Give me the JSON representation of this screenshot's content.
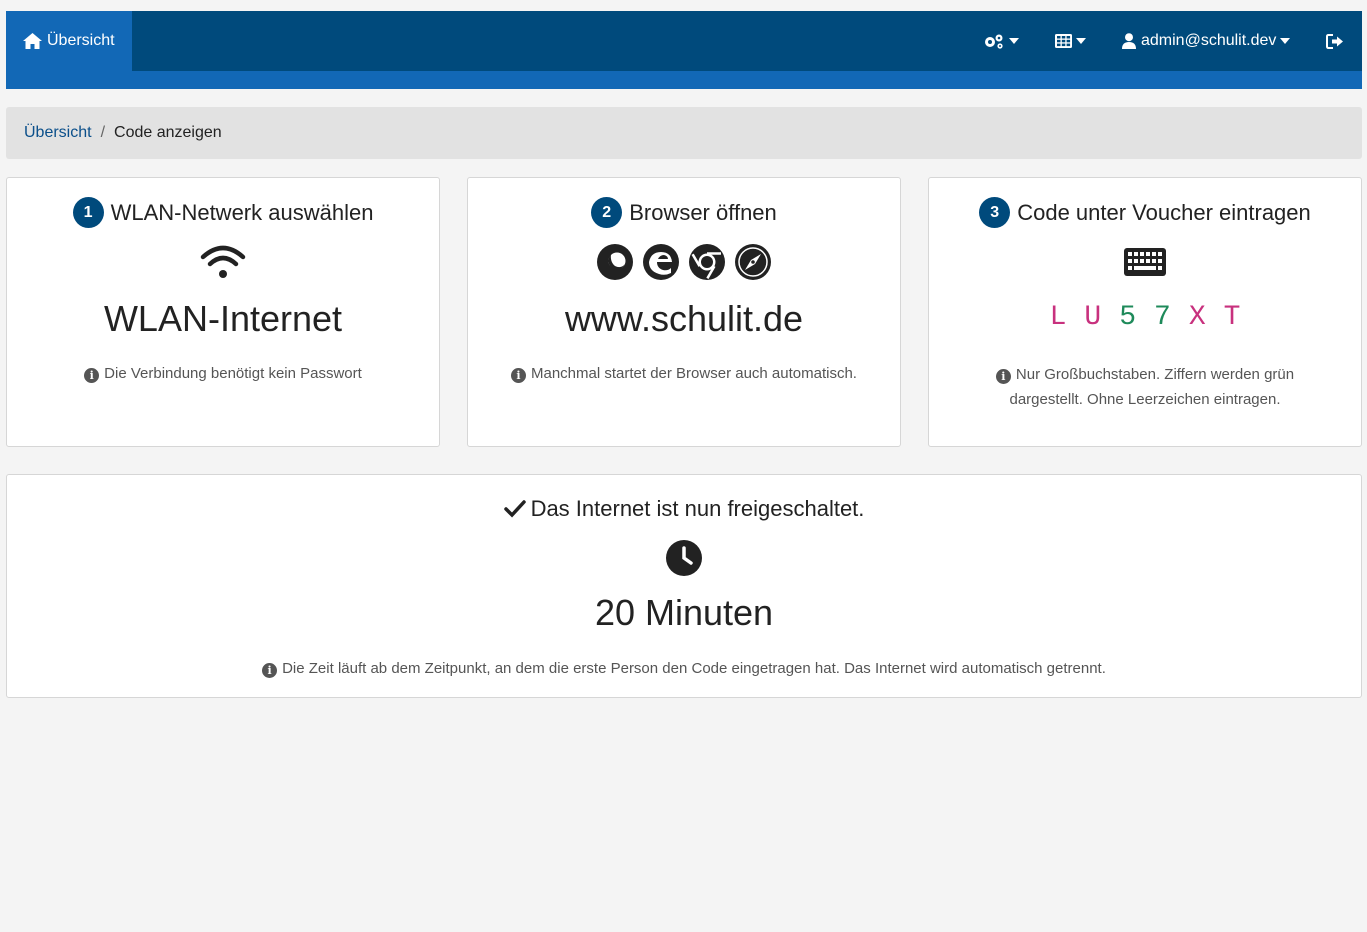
{
  "nav": {
    "home_label": "Übersicht",
    "user_label": "admin@schulit.dev"
  },
  "breadcrumb": {
    "home": "Übersicht",
    "separator": "/",
    "current": "Code anzeigen"
  },
  "steps": [
    {
      "number": "1",
      "title": "WLAN-Netwerk auswählen",
      "value": "WLAN-Internet",
      "info": "Die Verbindung benötigt kein Passwort",
      "icon": "wifi-icon"
    },
    {
      "number": "2",
      "title": "Browser öffnen",
      "value": "www.schulit.de",
      "info": "Manchmal startet der Browser auch automatisch.",
      "icons": [
        "firefox-icon",
        "edge-icon",
        "chrome-icon",
        "safari-icon"
      ]
    },
    {
      "number": "3",
      "title": "Code unter Voucher eintragen",
      "info": "Nur Großbuchstaben. Ziffern werden grün dargestellt. Ohne Leerzeichen eintragen.",
      "icon": "keyboard-icon",
      "code": [
        "L",
        "U",
        "5",
        "7",
        "X",
        "T"
      ]
    }
  ],
  "result": {
    "title": "Das Internet ist nun freigeschaltet.",
    "duration": "20 Minuten",
    "info": "Die Zeit läuft ab dem Zeitpunkt, an dem die erste Person den Code eingetragen hat. Das Internet wird automatisch getrennt."
  },
  "colors": {
    "nav_dark": "#004a7c",
    "nav_accent": "#1268b6",
    "code_letter": "#c8317e",
    "code_digit": "#1e8a5a"
  }
}
